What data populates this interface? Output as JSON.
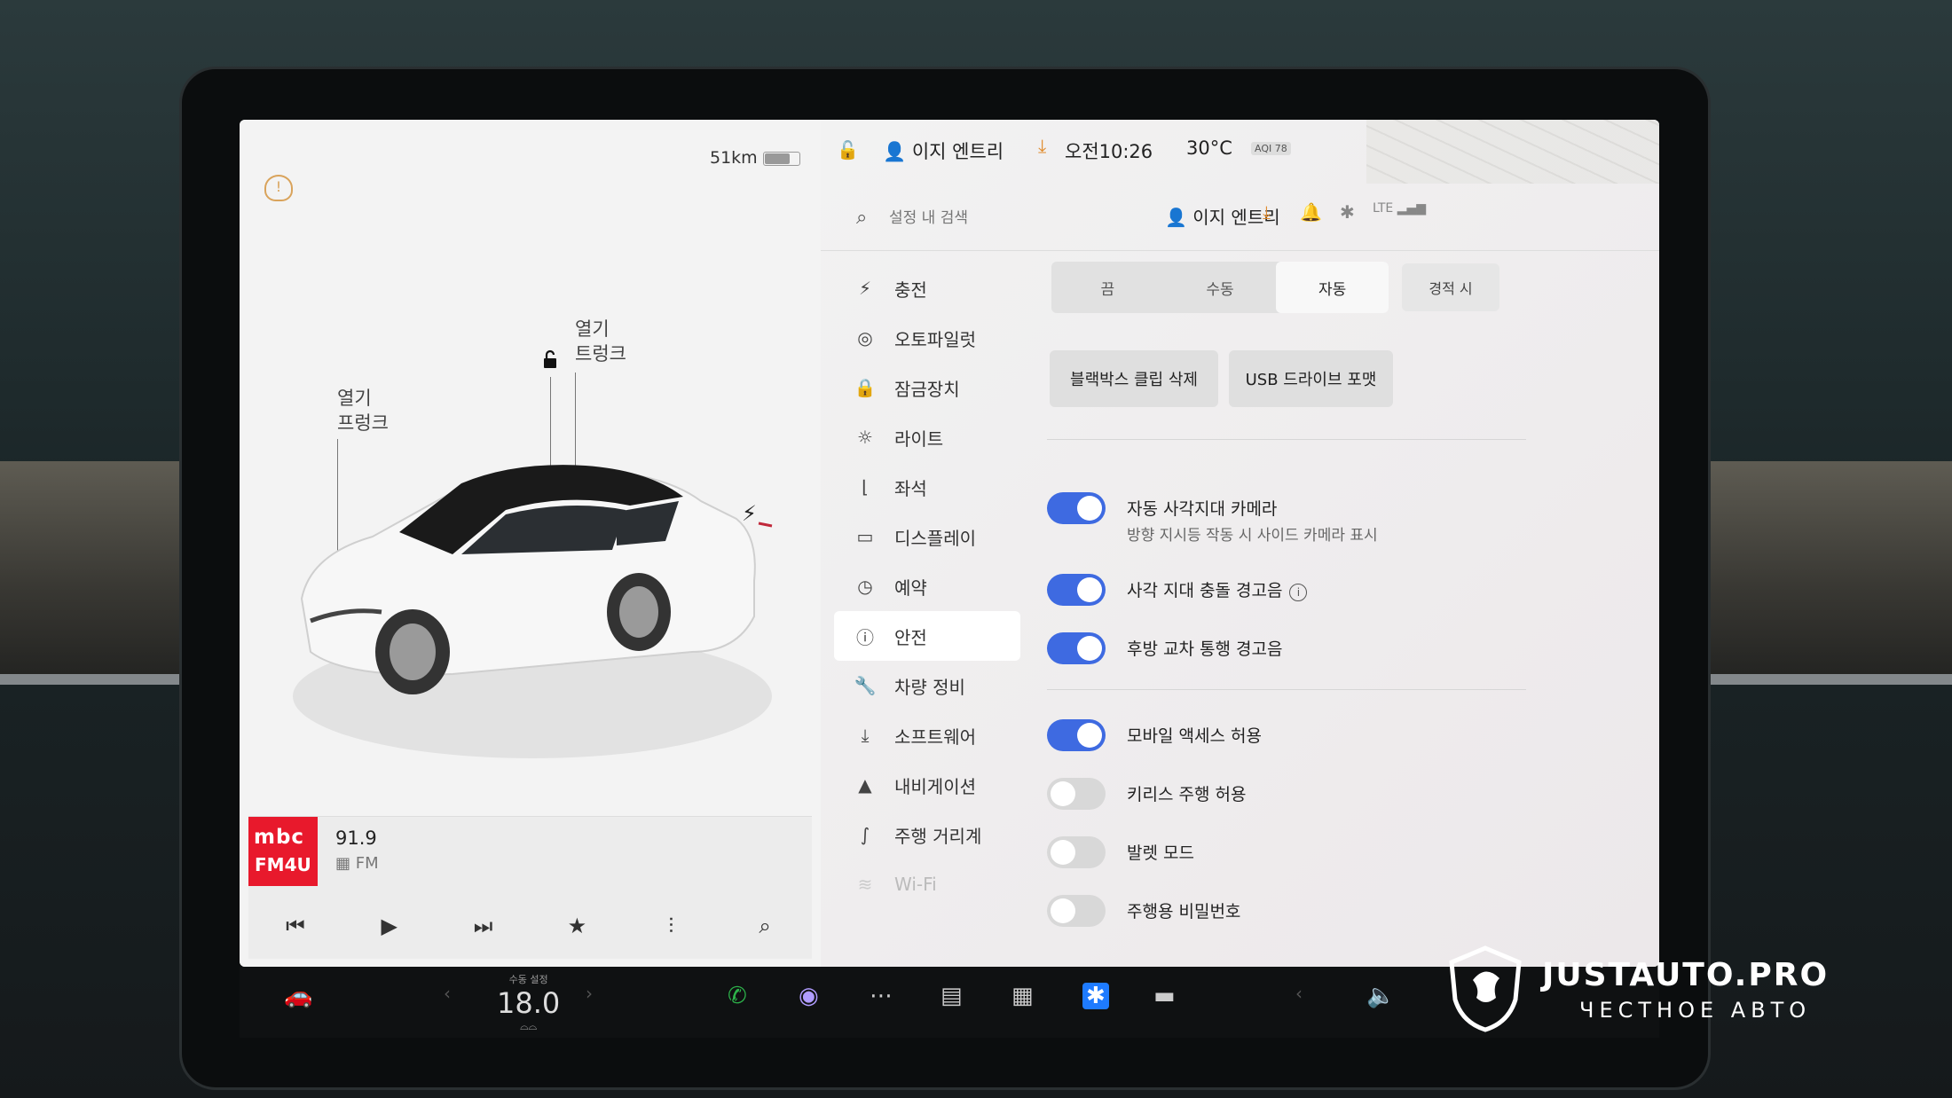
{
  "car": {
    "range": "51km",
    "frunk_label_1": "열기",
    "frunk_label_2": "프렁크",
    "trunk_label_1": "열기",
    "trunk_label_2": "트렁크",
    "body_color": "#f6f6f6"
  },
  "media": {
    "logo_line1": "mbc",
    "logo_line2": "FM4U",
    "station": "91.9",
    "band": "FM"
  },
  "status": {
    "profile": "이지 엔트리",
    "time": "오전10:26",
    "temperature": "30°C",
    "aqi": "AQI 78"
  },
  "topbar": {
    "search_placeholder": "설정 내 검색",
    "profile": "이지 엔트리",
    "lte": "LTE"
  },
  "nav": {
    "items": [
      {
        "label": "충전"
      },
      {
        "label": "오토파일럿"
      },
      {
        "label": "잠금장치"
      },
      {
        "label": "라이트"
      },
      {
        "label": "좌석"
      },
      {
        "label": "디스플레이"
      },
      {
        "label": "예약"
      },
      {
        "label": "안전"
      },
      {
        "label": "차량 정비"
      },
      {
        "label": "소프트웨어"
      },
      {
        "label": "내비게이션"
      },
      {
        "label": "주행 거리계"
      },
      {
        "label": "Wi-Fi"
      }
    ],
    "active_index": 7
  },
  "dashcam": {
    "options": [
      "끔",
      "수동",
      "자동"
    ],
    "selected": "자동",
    "extra": "경적 시"
  },
  "buttons": {
    "delete_clips": "블랙박스 클립 삭제",
    "format_usb": "USB 드라이브 포맷"
  },
  "toggles": [
    {
      "label": "자동 사각지대 카메라",
      "sub": "방향 지시등 작동 시 사이드 카메라 표시",
      "on": true
    },
    {
      "label": "사각 지대 충돌 경고음",
      "on": true
    },
    {
      "label": "후방 교차 통행 경고음",
      "on": true
    },
    {
      "label": "모바일 액세스 허용",
      "on": true
    },
    {
      "label": "키리스 주행 허용",
      "on": false
    },
    {
      "label": "발렛 모드",
      "on": false
    },
    {
      "label": "주행용 비밀번호",
      "on": false
    }
  ],
  "dock": {
    "temp_caption": "수동 설정",
    "temp_value": "18.0"
  },
  "watermark": {
    "brand": "JUSTAUTO.PRO",
    "tagline": "ЧЕСТНОЕ АВТО"
  },
  "colors": {
    "accent": "#3e6ae1",
    "alert": "#e08a2c",
    "mbc_red": "#e8192c"
  }
}
